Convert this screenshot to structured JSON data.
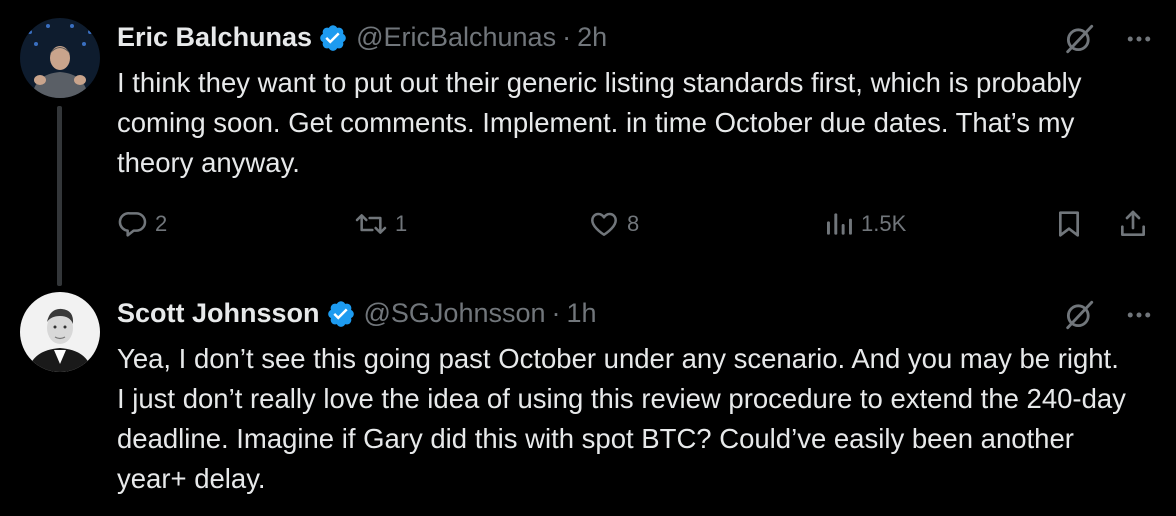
{
  "tweets": [
    {
      "author": {
        "name": "Eric Balchunas",
        "handle": "@EricBalchunas",
        "dot": "·",
        "time": "2h"
      },
      "text": "I think they want to put out their generic listing standards first, which is probably coming soon. Get comments. Implement. in time October due dates. That’s my theory anyway.",
      "metrics": {
        "replies": "2",
        "reposts": "1",
        "likes": "8",
        "views": "1.5K"
      }
    },
    {
      "author": {
        "name": "Scott Johnsson",
        "handle": "@SGJohnsson",
        "dot": "·",
        "time": "1h"
      },
      "text": "Yea, I don’t see this going past October under any scenario. And you may be right. I just don’t really love the idea of using this review procedure to extend the 240-day deadline. Imagine if Gary did this with spot BTC? Could’ve easily been another year+ delay."
    }
  ],
  "colors": {
    "background": "#000000",
    "text": "#e7e9ea",
    "muted": "#71767b",
    "verified": "#1d9bf0"
  },
  "icons": [
    "verified-badge-icon",
    "grok-icon",
    "more-icon",
    "reply-icon",
    "repost-icon",
    "like-icon",
    "views-icon",
    "bookmark-icon",
    "share-icon"
  ]
}
